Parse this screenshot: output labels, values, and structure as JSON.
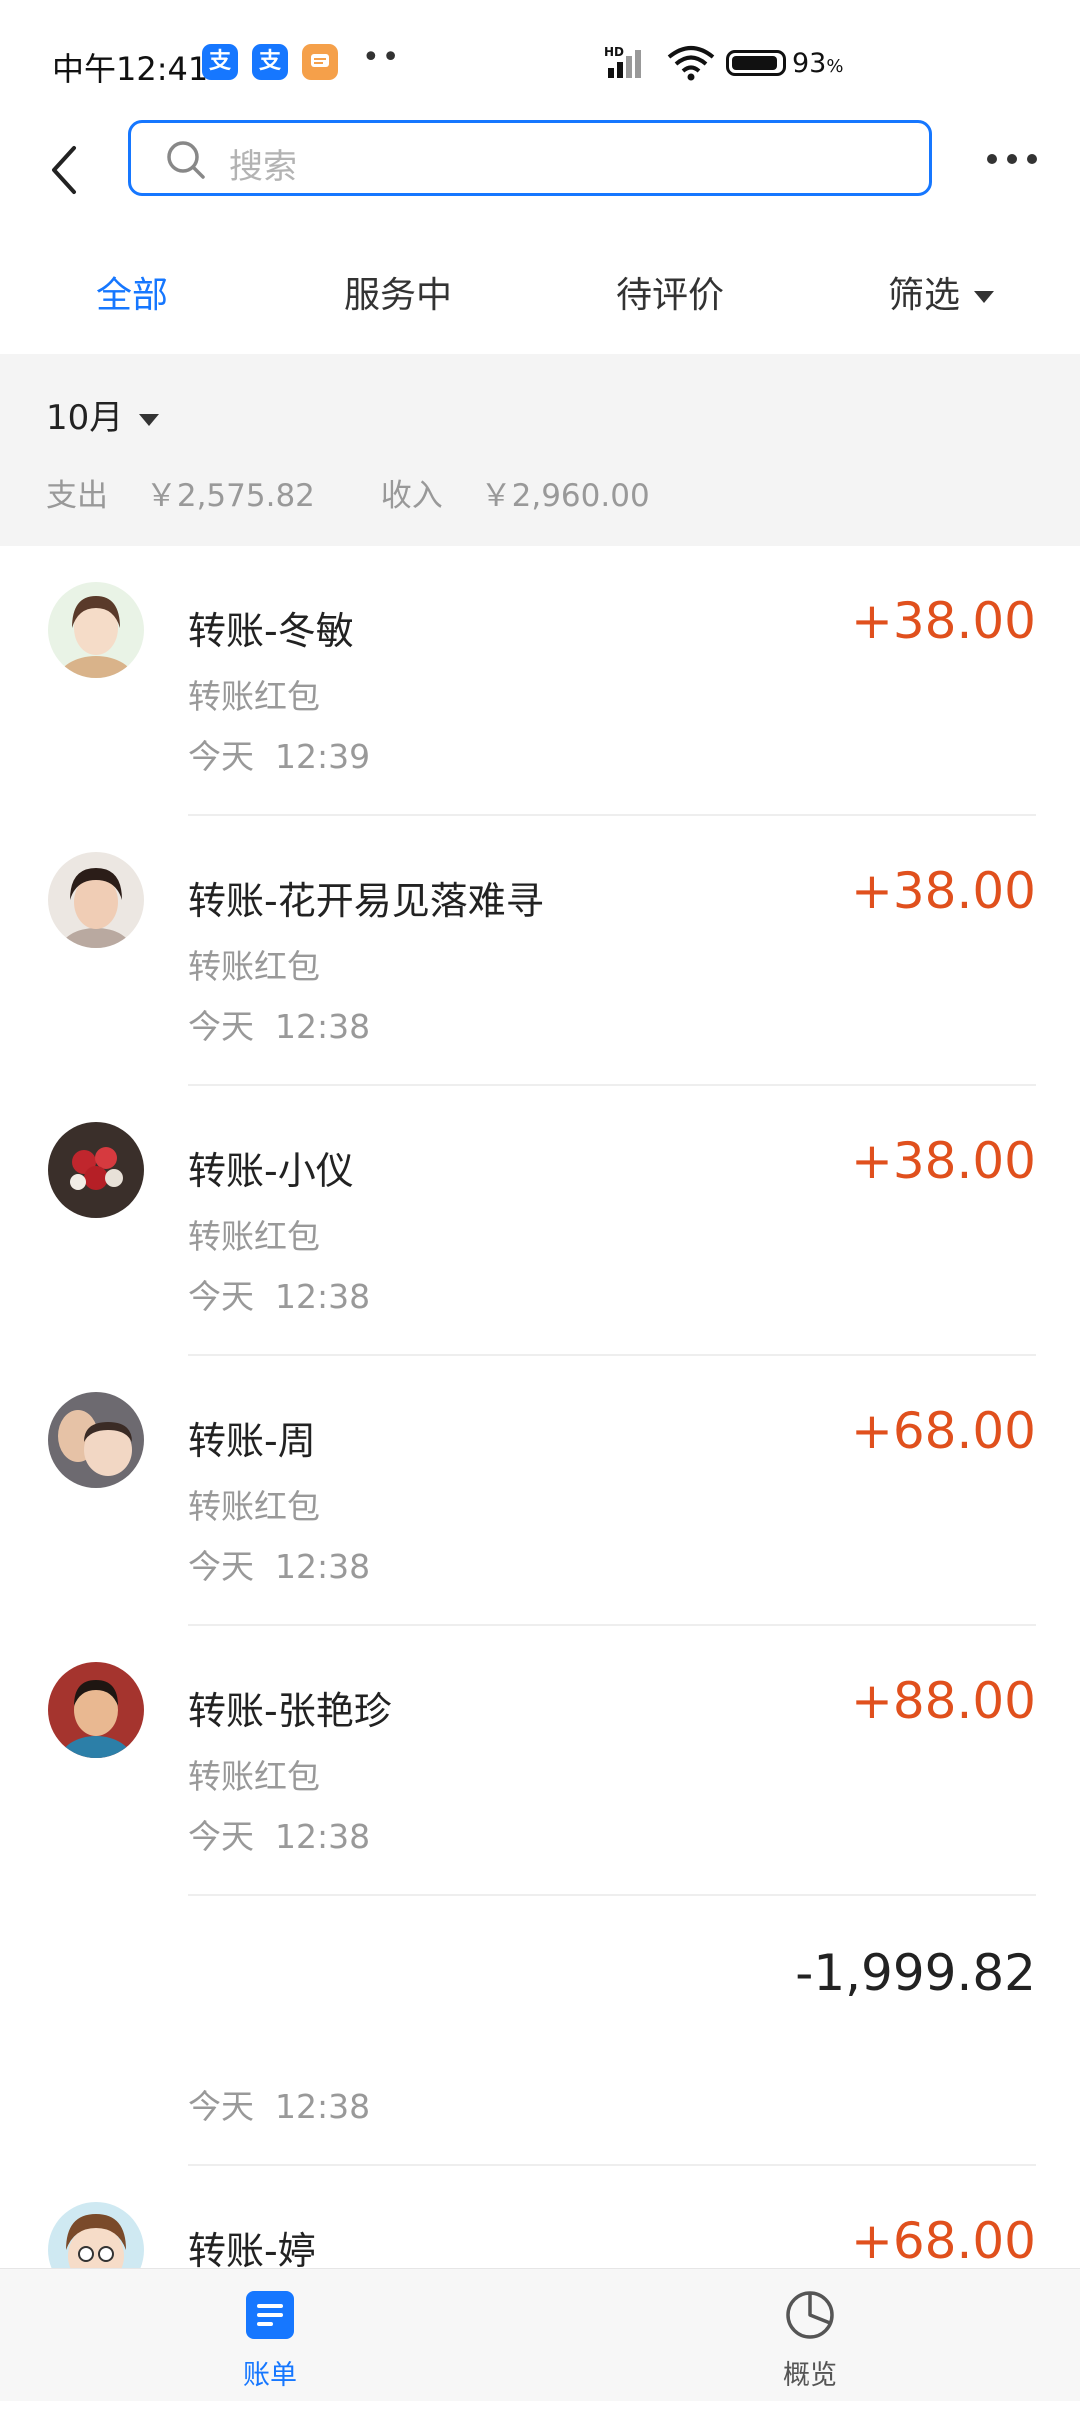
{
  "status_bar": {
    "time": "中午12:41",
    "apps": [
      {
        "icon": "alipay-app-icon",
        "glyph": "支",
        "color": "#1677ff"
      },
      {
        "icon": "alipay-app-icon",
        "glyph": "支",
        "color": "#1677ff"
      },
      {
        "icon": "message-app-icon",
        "glyph": "",
        "color": "#f5a04a"
      }
    ],
    "dots": "••",
    "network": "HD",
    "battery_percent": "93",
    "battery_unit": "%"
  },
  "header": {
    "search_placeholder": "搜索",
    "more_icon": "more-dots-icon",
    "back_icon": "back-arrow-icon"
  },
  "tabs": [
    {
      "label": "全部",
      "active": true
    },
    {
      "label": "服务中",
      "active": false
    },
    {
      "label": "待评价",
      "active": false
    },
    {
      "label": "筛选",
      "active": false
    }
  ],
  "summary": {
    "month": "10月",
    "expense_label": "支出",
    "expense_value": "￥2,575.82",
    "income_label": "收入",
    "income_value": "￥2,960.00"
  },
  "transactions": [
    {
      "title": "转账-冬敏",
      "subtitle": "转账红包",
      "day": "今天",
      "time": "12:39",
      "amount": "+38.00"
    },
    {
      "title": "转账-花开易见落难寻",
      "subtitle": "转账红包",
      "day": "今天",
      "time": "12:38",
      "amount": "+38.00"
    },
    {
      "title": "转账-小仪",
      "subtitle": "转账红包",
      "day": "今天",
      "time": "12:38",
      "amount": "+38.00"
    },
    {
      "title": "转账-周",
      "subtitle": "转账红包",
      "day": "今天",
      "time": "12:38",
      "amount": "+68.00"
    },
    {
      "title": "转账-张艳珍",
      "subtitle": "转账红包",
      "day": "今天",
      "time": "12:38",
      "amount": "+88.00"
    },
    {
      "title": "",
      "subtitle": "",
      "day": "今天",
      "time": "12:38",
      "amount": "-1,999.82"
    },
    {
      "title": "转账-婷",
      "subtitle": "",
      "day": "",
      "time": "",
      "amount": "+68.00"
    }
  ],
  "bottom_nav": [
    {
      "label": "账单",
      "icon": "bill-icon",
      "active": true
    },
    {
      "label": "概览",
      "icon": "pie-chart-icon",
      "active": false
    }
  ],
  "colors": {
    "accent": "#1677ff",
    "income": "#e0501d",
    "muted": "#999999"
  }
}
